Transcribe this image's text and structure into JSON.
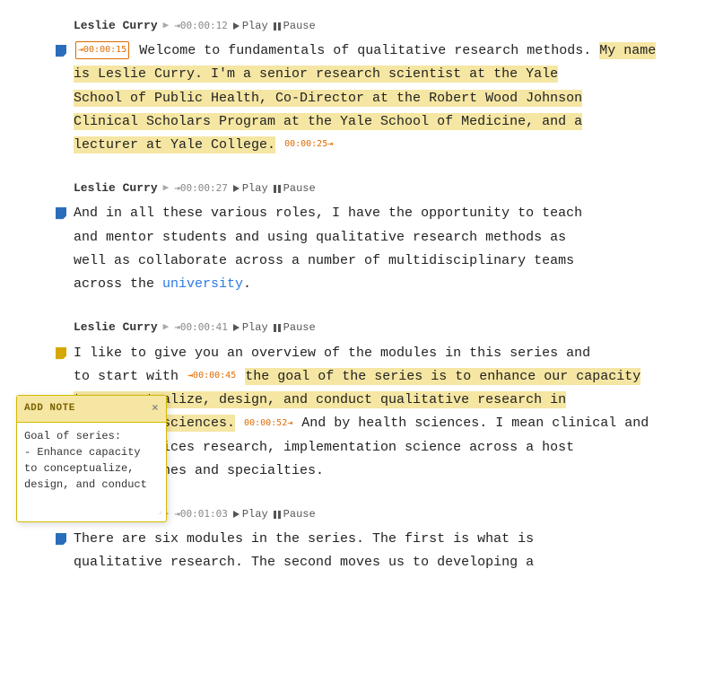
{
  "segments": [
    {
      "id": "seg1",
      "speaker": "Leslie Curry",
      "timestamp": "⇥00:00:12",
      "hasPlay": true,
      "hasPause": true,
      "noteColor": "blue",
      "timestampEnd": "00:00:15",
      "text_parts": [
        {
          "type": "text",
          "content": "Welcome to fundamentals of qualitative research methods. "
        },
        {
          "type": "highlight",
          "content": "My name is Leslie Curry. I'm a senior research scientist at the Yale School of Public Health, Co-Director at the Robert Wood Johnson Clinical Scholars Program at the Yale School of Medicine, and a lecturer at Yale College."
        },
        {
          "type": "ts",
          "content": "00:00:25⇥"
        }
      ]
    },
    {
      "id": "seg2",
      "speaker": "Leslie Curry",
      "timestamp": "⇥00:00:27",
      "hasPlay": true,
      "hasPause": true,
      "noteColor": "blue",
      "text_parts": [
        {
          "type": "text",
          "content": "And in all these various roles, I have the opportunity to teach and mentor students and using qualitative research methods as well as collaborate across a number of multidisciplinary teams across the "
        },
        {
          "type": "link",
          "content": "university"
        },
        {
          "type": "text",
          "content": "."
        }
      ]
    },
    {
      "id": "seg3",
      "speaker": "Leslie Curry",
      "timestamp": "⇥00:00:41",
      "hasPlay": true,
      "hasPause": true,
      "noteColor": "yellow",
      "text_parts": [
        {
          "type": "text",
          "content": "I like to give you an overview of the modules in this series and to start with "
        },
        {
          "type": "ts_inline_start",
          "content": "⇥00:00:45"
        },
        {
          "type": "highlight",
          "content": "the goal of the series is to enhance our capacity to conceptualize, design, and conduct qualitative research in the health sciences."
        },
        {
          "type": "ts_inline_end",
          "content": "00:00:52⇥"
        },
        {
          "type": "text",
          "content": " And by health sciences. I mean clinical and health services research, implementation science across a host of disciplines and specialties."
        }
      ]
    },
    {
      "id": "seg4",
      "speaker": "Leslie Curry",
      "timestamp": "⇥00:01:03",
      "hasPlay": true,
      "hasPause": true,
      "noteColor": "blue",
      "text_parts": [
        {
          "type": "text",
          "content": "There are six modules in the series. The first is what is qualitative research. The second moves us to developing a"
        }
      ]
    }
  ],
  "addNote": {
    "title": "ADD NOTE",
    "closeLabel": "×",
    "content": "Goal of series:\n- Enhance capacity to conceptualize, design, and conduct qualitative research in the health sciences"
  },
  "labels": {
    "play": "Play",
    "pause": "Pause"
  }
}
